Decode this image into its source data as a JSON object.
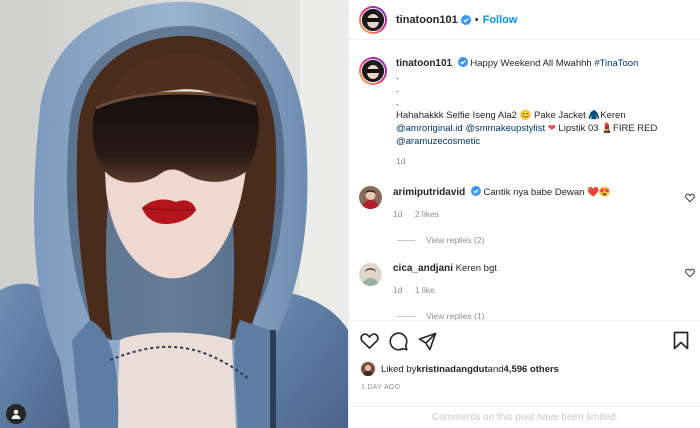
{
  "header": {
    "username": "tinatoon101",
    "separator": "•",
    "follow_label": "Follow"
  },
  "caption": {
    "username": "tinatoon101",
    "line1_text": " Happy Weekend All Mwahhh ",
    "hashtag": "#TinaToon",
    "dot1": ".",
    "dot2": ".",
    "dot3": ".",
    "line2_text": "Hahahakkk Selfie Iseng Ala2 😊 Pake Jacket 🧥Keren",
    "mention1": "@amroriginal.id",
    "mention2": "@smmakeupstylist",
    "heart": "❤",
    "lipstik_text": " Lipstik 03 💄FIRE RED",
    "mention3": "@aramuzecosmetic",
    "time": "1d"
  },
  "comments": [
    {
      "username": "arimiputridavid",
      "text": "Cantik nya babe Dewan ❤️😍",
      "time": "1d",
      "likes": "2 likes",
      "replies": "View replies (2)"
    },
    {
      "username": "cica_andjani",
      "text": "Keren bgt",
      "time": "1d",
      "likes": "1 like",
      "replies": "View replies (1)"
    }
  ],
  "likes_row": {
    "prefix": "Liked by ",
    "liker": "kristinadangdut",
    "middle": " and ",
    "count": "4,596 others"
  },
  "time_ago": "1 DAY AGO",
  "comments_limited": "Comments on this post have been limited.",
  "colors": {
    "accent": "#0095f6",
    "heart": "#ed4956",
    "muted": "#8e8e8e",
    "border": "#efefef"
  }
}
